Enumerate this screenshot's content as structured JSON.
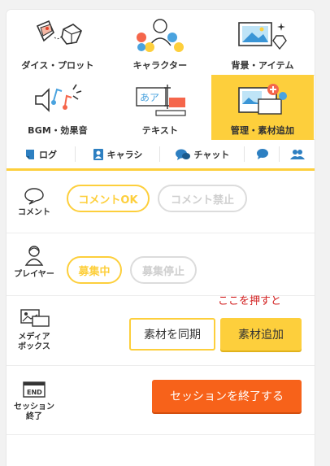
{
  "grid": [
    {
      "label": "ダイス・プロット",
      "icon": "dice-icon"
    },
    {
      "label": "キャラクター",
      "icon": "characters-icon"
    },
    {
      "label": "背景・アイテム",
      "icon": "background-item-icon"
    },
    {
      "label": "BGM・効果音",
      "icon": "bgm-sound-icon"
    },
    {
      "label": "テキスト",
      "icon": "text-icon"
    },
    {
      "label": "管理・素材追加",
      "icon": "manage-add-material-icon"
    }
  ],
  "tabs": [
    {
      "label": "ログ",
      "icon": "log-icon"
    },
    {
      "label": "キャラシ",
      "icon": "charasheet-icon"
    },
    {
      "label": "チャット",
      "icon": "chat-icon"
    },
    {
      "label": "",
      "icon": "speech-bubble-icon"
    },
    {
      "label": "",
      "icon": "users-icon"
    }
  ],
  "comment": {
    "label": "コメント",
    "on": "コメントOK",
    "off": "コメント禁止"
  },
  "player": {
    "label": "プレイヤー",
    "on": "募集中",
    "off": "募集停止"
  },
  "media": {
    "label_line1": "メディア",
    "label_line2": "ボックス",
    "sync": "素材を同期",
    "add": "素材追加",
    "note": "ここを押すと"
  },
  "session": {
    "label_line1": "セッション",
    "label_line2": "終了",
    "end_icon_text": "END",
    "end_button": "セッションを終了する"
  },
  "colors": {
    "accent": "#fdcf3c",
    "danger": "#f7621a",
    "note": "#d21f1f"
  }
}
